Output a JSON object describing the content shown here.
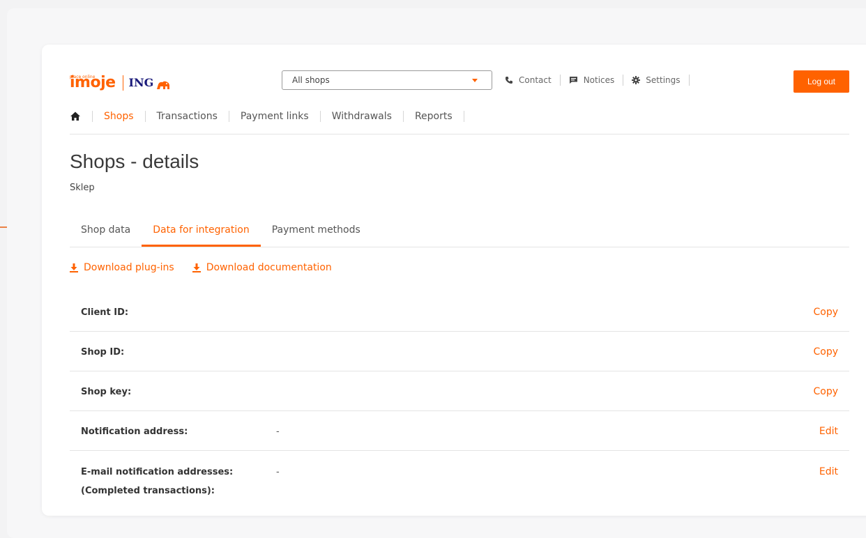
{
  "logo": {
    "imoje_text": "imoje",
    "small_text": "płacę online",
    "ing_text": "ING"
  },
  "shop_select": {
    "value": "All shops"
  },
  "top_links": [
    {
      "label": "Contact",
      "icon": "phone-icon"
    },
    {
      "label": "Notices",
      "icon": "message-icon"
    },
    {
      "label": "Settings",
      "icon": "gear-icon"
    }
  ],
  "logout_label": "Log out",
  "nav": {
    "home_icon": "home-icon",
    "items": [
      "Shops",
      "Transactions",
      "Payment links",
      "Withdrawals",
      "Reports"
    ],
    "active": "Shops"
  },
  "page": {
    "title": "Shops - details",
    "subtitle": "Sklep"
  },
  "sub_tabs": {
    "items": [
      "Shop data",
      "Data for integration",
      "Payment methods"
    ],
    "active": "Data for integration"
  },
  "downloads": [
    {
      "label": "Download plug-ins",
      "icon": "download-icon"
    },
    {
      "label": "Download documentation",
      "icon": "download-icon"
    }
  ],
  "rows": [
    {
      "label": "Client ID:",
      "value": "",
      "action": "Copy"
    },
    {
      "label": "Shop ID:",
      "value": "",
      "action": "Copy"
    },
    {
      "label": "Shop key:",
      "value": "",
      "action": "Copy"
    },
    {
      "label": "Notification address:",
      "value": "-",
      "action": "Edit"
    },
    {
      "label_line1": "E-mail notification addresses:",
      "label_line2": "(Completed transactions):",
      "value": "-",
      "action": "Edit"
    }
  ],
  "colors": {
    "accent": "#ff6200",
    "ing_blue": "#1a1a7a",
    "text": "#333333",
    "divider": "#e4e4e4"
  }
}
